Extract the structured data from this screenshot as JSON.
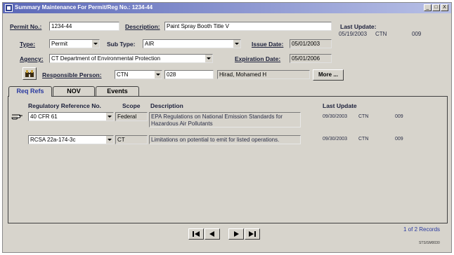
{
  "window": {
    "title": "Summary Maintenance For Permit/Reg No.: 1234-44",
    "controls": {
      "minimize": "_",
      "restore": "□",
      "close": "X"
    }
  },
  "form": {
    "permit_no": {
      "label": "Permit No.:",
      "value": "1234-44"
    },
    "description": {
      "label": "Description:",
      "value": "Paint Spray Booth Title V"
    },
    "last_update": {
      "label": "Last Update:",
      "date": "05/19/2003",
      "user": "CTN",
      "code": "009"
    },
    "type": {
      "label": "Type:",
      "value": "Permit"
    },
    "sub_type": {
      "label": "Sub Type:",
      "value": "AIR"
    },
    "issue_date": {
      "label": "Issue Date:",
      "value": "05/01/2003"
    },
    "agency": {
      "label": "Agency:",
      "value": "CT Department of Environmental Protection"
    },
    "expiration_date": {
      "label": "Expiration Date:",
      "value": "05/01/2006"
    },
    "responsible_person": {
      "label": "Responsible Person:",
      "code": "CTN",
      "number": "028",
      "name": "Hirad, Mohamed H"
    },
    "more_button": "More ..."
  },
  "tabs": [
    {
      "label": "Req Refs",
      "active": true
    },
    {
      "label": "NOV",
      "active": false
    },
    {
      "label": "Events",
      "active": false
    }
  ],
  "table": {
    "headers": [
      "Regulatory Reference No.",
      "Scope",
      "Description",
      "Last Update"
    ],
    "rows": [
      {
        "ref": "40 CFR 61",
        "scope": "Federal",
        "description": "EPA Regulations on National Emission Standards for Hazardous Air Pollutants",
        "date": "09/30/2003",
        "user": "CTN",
        "code": "009"
      },
      {
        "ref": "RCSA 22a-174-3c",
        "scope": "CT",
        "description": "Limitations on potential to emit for listed operations.",
        "date": "09/30/2003",
        "user": "CTN",
        "code": "009"
      }
    ]
  },
  "footer": {
    "record_count": "1 of 2 Records",
    "form_id": "STS/SM0030"
  },
  "icons": {
    "pointer": "pointing-hand-icon",
    "person_lookup": "binoculars-icon"
  }
}
